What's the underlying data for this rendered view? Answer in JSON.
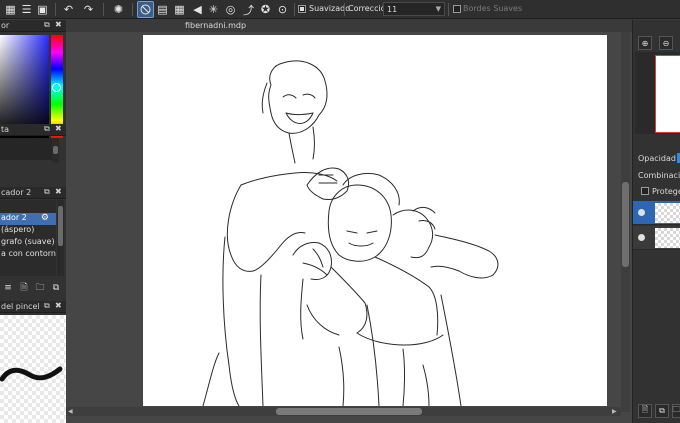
{
  "toolbar": {
    "buttons": [
      {
        "name": "new-canvas-icon",
        "glyph": "▦"
      },
      {
        "name": "layers-view-icon",
        "glyph": "☰"
      },
      {
        "name": "grid-view-icon",
        "glyph": "▣"
      },
      {
        "name": "undo-icon",
        "glyph": "↶"
      },
      {
        "name": "redo-icon",
        "glyph": "↷"
      },
      {
        "name": "loading-icon",
        "glyph": "✺"
      },
      {
        "name": "ruler-line-icon",
        "glyph": "⃠"
      },
      {
        "name": "parallel-ruler-icon",
        "glyph": "▤"
      },
      {
        "name": "grid-ruler-icon",
        "glyph": "▦"
      },
      {
        "name": "perspective-ruler-icon",
        "glyph": "◀"
      },
      {
        "name": "radial-ruler-icon",
        "glyph": "✳"
      },
      {
        "name": "concentric-ruler-icon",
        "glyph": "◎"
      },
      {
        "name": "curve-ruler-icon",
        "glyph": "⤴"
      },
      {
        "name": "ellipse-ruler-icon",
        "glyph": "✪"
      },
      {
        "name": "circle-ruler-icon",
        "glyph": "⊙"
      }
    ],
    "suavizado_label": "Suavizado",
    "suavizado_checked": true,
    "correccion_label": "Corrección",
    "correccion_value": "11",
    "bordes_label": "Bordes Suaves",
    "bordes_checked": false
  },
  "left_panel": {
    "color_title": "or",
    "palette_title": "ta",
    "brush_title": "cador 2",
    "brushes": [
      {
        "label": "",
        "selected": false
      },
      {
        "label": "ador 2",
        "selected": true
      },
      {
        "label": "(áspero)",
        "selected": false
      },
      {
        "label": "grafo (suave)",
        "selected": false
      },
      {
        "label": "a con contorno",
        "selected": false
      }
    ],
    "brush_buttons": [
      "≡",
      "🗎",
      "🗀",
      "⧉"
    ],
    "preview_title": "del pincel"
  },
  "canvas": {
    "filename": "fibernadni.mdp"
  },
  "right_panel": {
    "opacity_label": "Opacidad",
    "blend_label": "Combinación",
    "protect_label": "Proteger a"
  },
  "colors": {
    "accent": "#3f6fb0",
    "toolbar_bg": "#2f2f2f",
    "panel_bg": "#323232",
    "canvas_bg": "#464646",
    "paper": "#ffffff",
    "nav_frame": "#e23a3a"
  }
}
